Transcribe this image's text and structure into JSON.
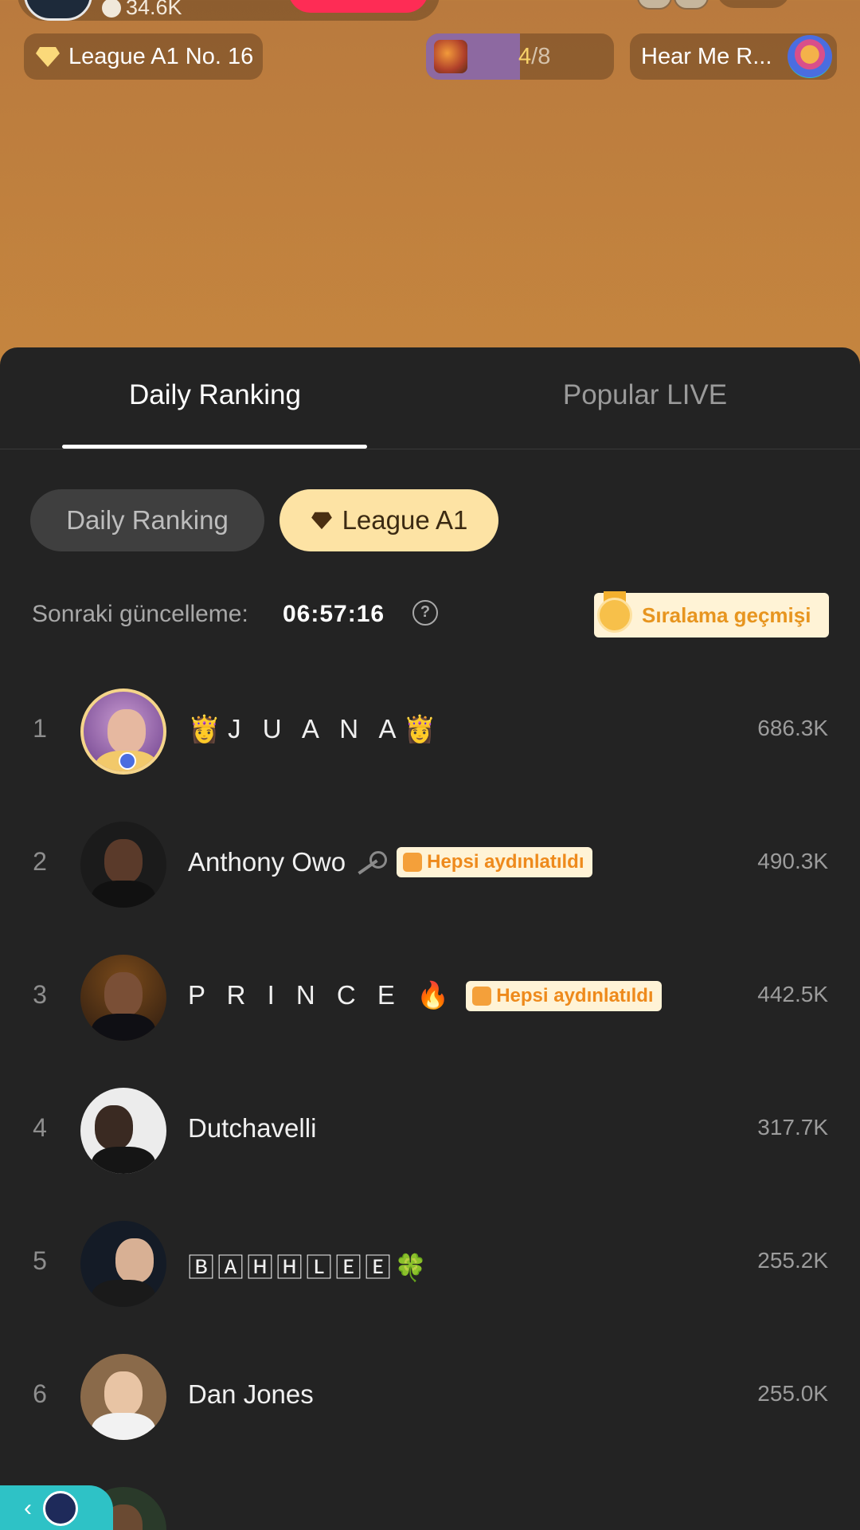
{
  "live_header": {
    "likes": "34.6K",
    "league_chip": "League A1 No. 16",
    "progress": {
      "current": "4",
      "total": "/8",
      "fraction": 0.5
    },
    "song_chip": "Hear Me R..."
  },
  "tabs": [
    {
      "label": "Daily Ranking",
      "active": true
    },
    {
      "label": "Popular LIVE",
      "active": false
    }
  ],
  "subtabs": [
    {
      "label": "Daily Ranking",
      "active": false
    },
    {
      "label": "League A1",
      "active": true
    }
  ],
  "update": {
    "label": "Sonraki güncelleme:",
    "time": "06:57:16",
    "help": "?",
    "history_button": "Sıralama geçmişi"
  },
  "ranking": [
    {
      "rank": "1",
      "name": "👸J U A N A👸",
      "score": "686.3K",
      "tag": ""
    },
    {
      "rank": "2",
      "name": "Anthony Owo",
      "score": "490.3K",
      "tag": "Hepsi aydınlatıldı"
    },
    {
      "rank": "3",
      "name": "P R I N C E 🔥",
      "score": "442.5K",
      "tag": "Hepsi aydınlatıldı"
    },
    {
      "rank": "4",
      "name": "Dutchavelli",
      "score": "317.7K",
      "tag": ""
    },
    {
      "rank": "5",
      "name": "🄱🄰🄷🄷🄻🄴🄴🍀",
      "score": "255.2K",
      "tag": ""
    },
    {
      "rank": "6",
      "name": "Dan Jones",
      "score": "255.0K",
      "tag": ""
    }
  ],
  "colors": {
    "accent": "#fde3a4",
    "tag_text": "#ee8a1c",
    "sheet_bg": "#232323",
    "live_bg": "#c8883f"
  },
  "icons": [
    "heart-icon",
    "diamond-icon",
    "gift-icon",
    "lion-icon",
    "help-icon",
    "medal-icon",
    "key-icon",
    "chevron-left-icon"
  ]
}
